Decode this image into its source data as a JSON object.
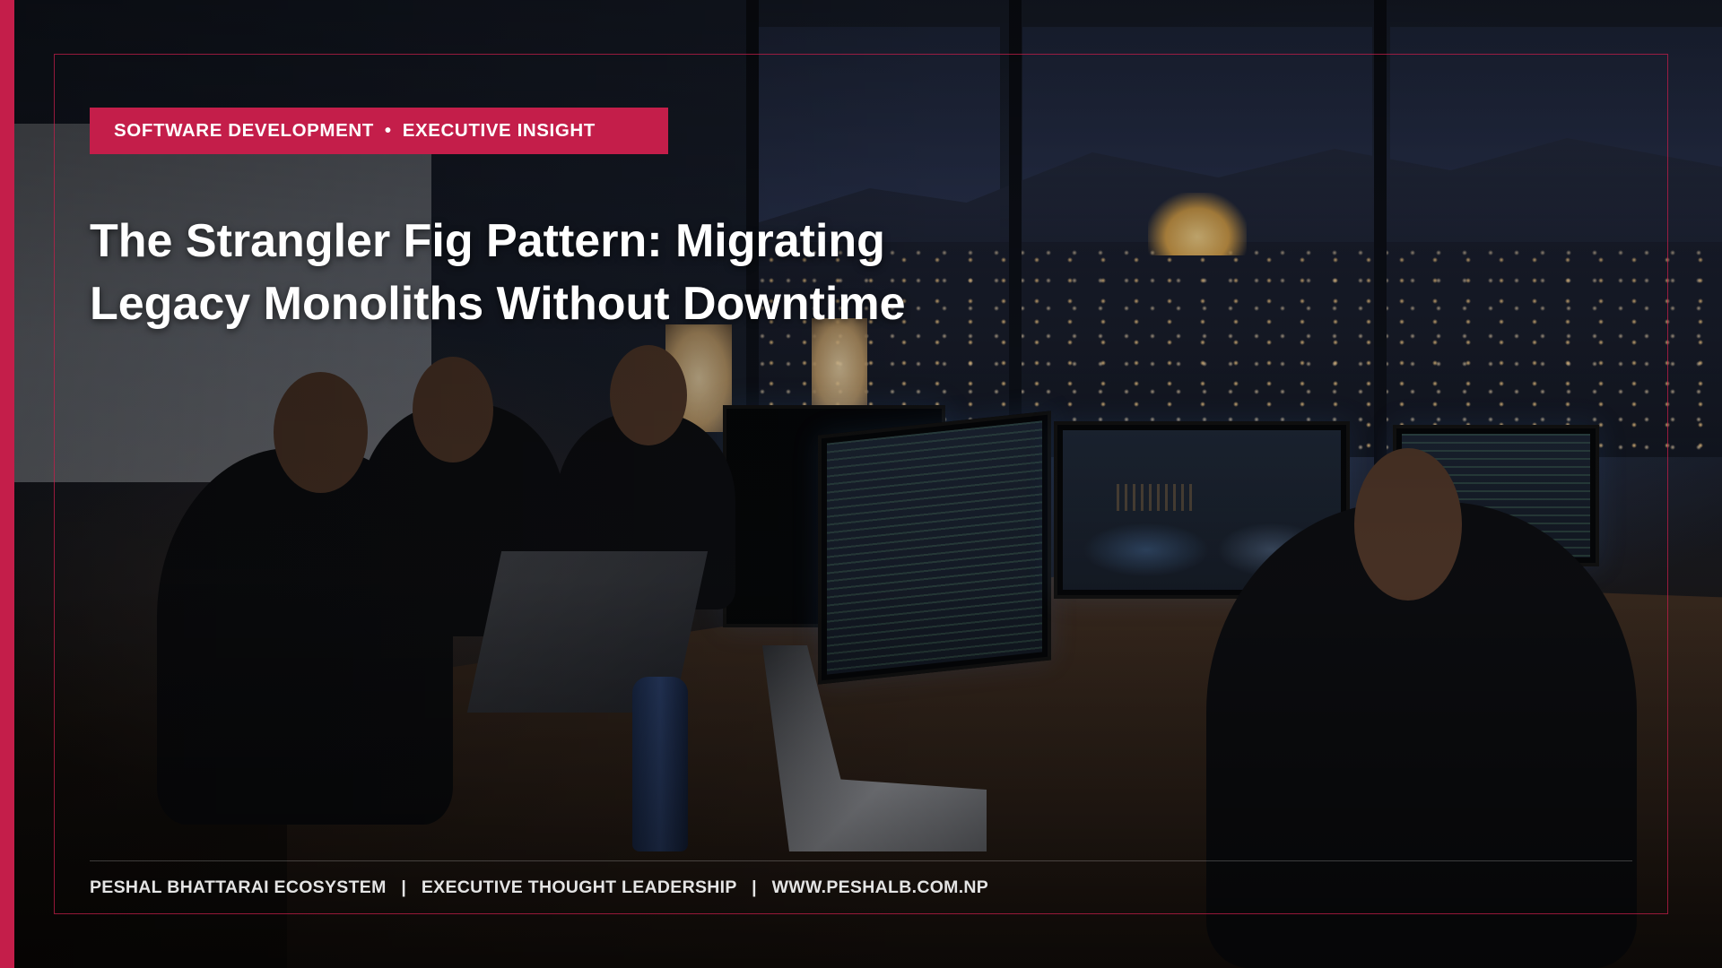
{
  "badge": {
    "category": "SOFTWARE DEVELOPMENT",
    "separator": "•",
    "subcategory": "EXECUTIVE INSIGHT"
  },
  "headline": {
    "line1": "The Strangler Fig Pattern: Migrating",
    "line2": "Legacy Monoliths Without Downtime"
  },
  "footer": {
    "brand": "PESHAL BHATTARAI ECOSYSTEM",
    "separator": "|",
    "tagline": "EXECUTIVE THOUGHT LEADERSHIP",
    "url": "WWW.PESHALB.COM.NP"
  },
  "colors": {
    "accent": "#c41e4a",
    "text": "#ffffff",
    "footer_text": "#e4e4e4"
  }
}
